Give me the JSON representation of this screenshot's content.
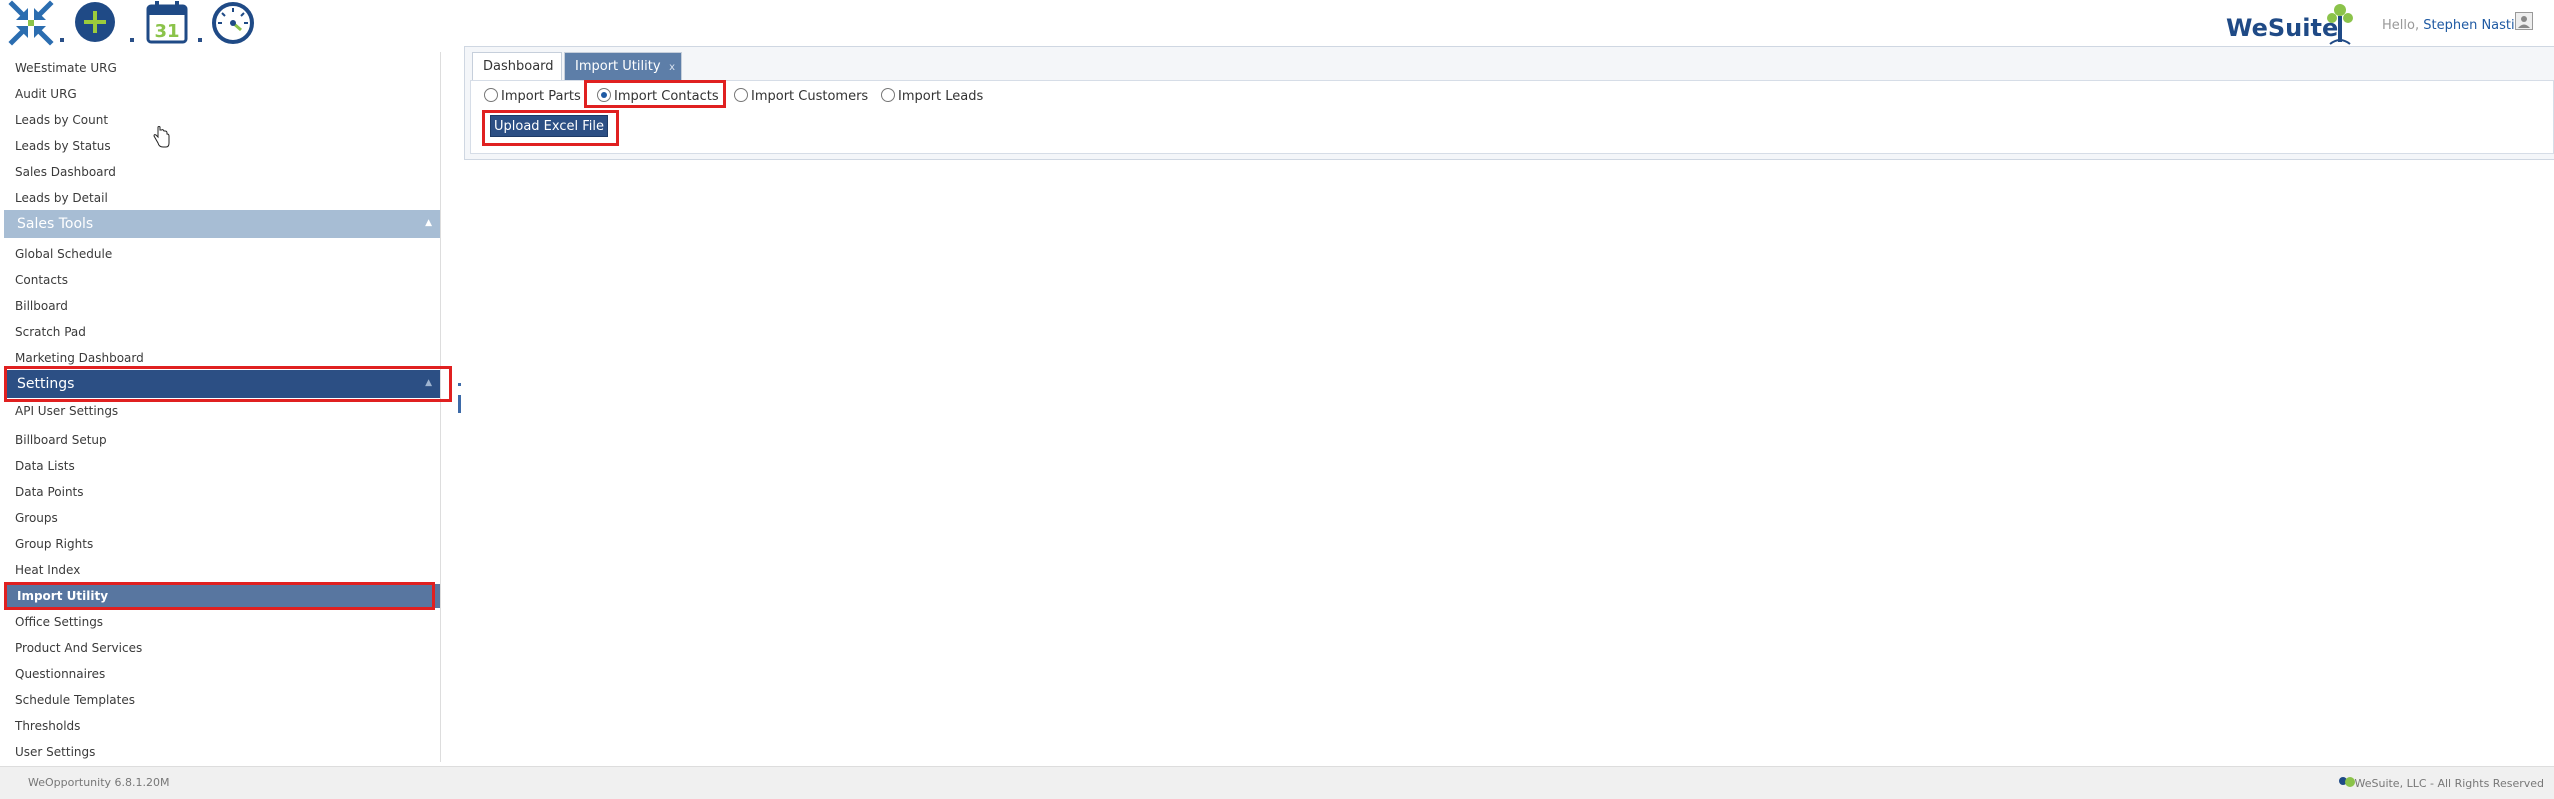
{
  "toolbar": {
    "icons": [
      "collapse-arrows-icon",
      "add-circle-icon",
      "calendar-icon",
      "dashboard-gauge-icon"
    ],
    "calendar_day": "31"
  },
  "brand": {
    "logo_text": "WeSuite",
    "color": "#1f4a86"
  },
  "header": {
    "greeting": "Hello,",
    "user_name": "Stephen Nasti"
  },
  "sidebar": {
    "reports_items": [
      "WeEstimate URG",
      "Audit URG",
      "Leads by Count",
      "Leads by Status",
      "Sales Dashboard",
      "Leads by Detail"
    ],
    "sales_tools_label": "Sales Tools",
    "sales_tools_items": [
      "Global Schedule",
      "Contacts",
      "Billboard",
      "Scratch Pad",
      "Marketing Dashboard"
    ],
    "settings_label": "Settings",
    "settings_items": [
      "API User Settings",
      "Billboard Setup",
      "Data Lists",
      "Data Points",
      "Groups",
      "Group Rights",
      "Heat Index",
      "Import Utility",
      "Office Settings",
      "Product And Services",
      "Questionnaires",
      "Schedule Templates",
      "Thresholds",
      "User Settings"
    ],
    "active_item": "Import Utility",
    "collapse_arrow": "▲"
  },
  "main": {
    "tabs": [
      "Dashboard",
      "Import Utility"
    ],
    "tab_close": "x",
    "import_options": [
      "Import Parts",
      "Import Contacts",
      "Import Customers",
      "Import Leads"
    ],
    "selected_option": "Import Contacts",
    "upload_button": "Upload Excel File"
  },
  "footer": {
    "version": "WeOpportunity 6.8.1.20M",
    "copyright": "WeSuite, LLC - All Rights Reserved"
  },
  "colors": {
    "accent": "#2c4f84",
    "highlight": "#e02020",
    "sales_header": "#a7bdd4",
    "active_tab": "#5d7ea8"
  }
}
